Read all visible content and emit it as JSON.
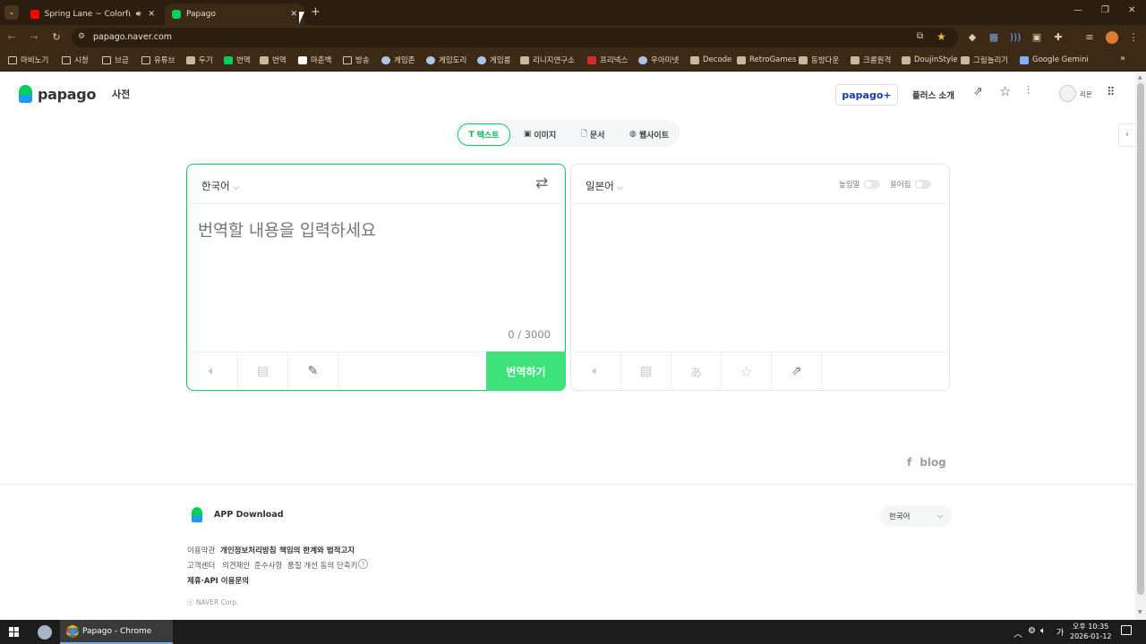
{
  "browser": {
    "tabs": [
      {
        "title": "Spring Lane ~ Colorful Pa"
      },
      {
        "title": "Papago"
      }
    ],
    "url": "papago.naver.com",
    "bookmarks": [
      {
        "label": "마비노기",
        "icon": "folder"
      },
      {
        "label": "시청",
        "icon": "folder"
      },
      {
        "label": "브금",
        "icon": "folder"
      },
      {
        "label": "유튜브",
        "icon": "folder"
      },
      {
        "label": "두기",
        "icon": "site"
      },
      {
        "label": "번역",
        "icon": "papago"
      },
      {
        "label": "번역",
        "icon": "site"
      },
      {
        "label": "마춘백",
        "icon": "k"
      },
      {
        "label": "방송",
        "icon": "folder"
      },
      {
        "label": "게임존",
        "icon": "globe"
      },
      {
        "label": "게임도리",
        "icon": "globe"
      },
      {
        "label": "게임룸",
        "icon": "globe"
      },
      {
        "label": "리니지연구소",
        "icon": "site"
      },
      {
        "label": "프리넥스",
        "icon": "f"
      },
      {
        "label": "우아미넷",
        "icon": "globe"
      },
      {
        "label": "Decode",
        "icon": "site"
      },
      {
        "label": "RetroGames",
        "icon": "site"
      },
      {
        "label": "동방다운",
        "icon": "site"
      },
      {
        "label": "크롬원격",
        "icon": "site"
      },
      {
        "label": "DoujinStyle",
        "icon": "site"
      },
      {
        "label": "그림놀리기",
        "icon": "site"
      },
      {
        "label": "Google Gemini",
        "icon": "gemini"
      }
    ]
  },
  "header": {
    "logo": "papago",
    "dict": "사전",
    "plus_badge": "papago+",
    "plus_intro": "플러스 소개",
    "user": "리온"
  },
  "modes": [
    {
      "label": "텍스트"
    },
    {
      "label": "이미지"
    },
    {
      "label": "문서"
    },
    {
      "label": "웹사이트"
    }
  ],
  "source": {
    "language": "한국어",
    "placeholder": "번역할 내용을 입력하세요",
    "counter": "0 / 3000",
    "translate_button": "번역하기"
  },
  "target": {
    "language": "일본어",
    "honorific": "높임말",
    "glossary": "용어집"
  },
  "blog": "blog",
  "footer": {
    "app_download": "APP Download",
    "language": "한국어",
    "row1": [
      "이용약관",
      "개인정보처리방침",
      "책임의 한계와 법적고지"
    ],
    "row2": [
      "고객센터",
      "의견제안",
      "준수사항",
      "품질 개선 동의",
      "단축키"
    ],
    "row3": [
      "제휴·API 이용문의"
    ],
    "copyright": "ⓒ NAVER Corp."
  },
  "taskbar": {
    "app": "Papago - Chrome",
    "time": "오후 10:35",
    "date": "2026-01-12",
    "ime": "가"
  },
  "colors": {
    "accent": "#03cf5d",
    "translate_button": "#3ee27a"
  }
}
